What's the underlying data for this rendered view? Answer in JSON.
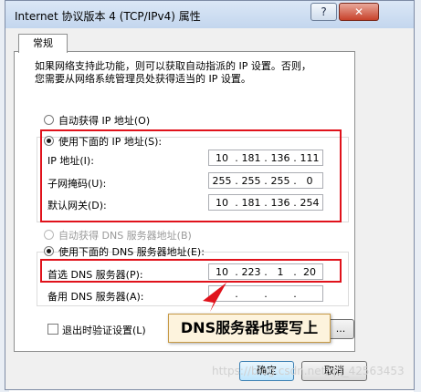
{
  "window": {
    "title": "Internet 协议版本 4 (TCP/IPv4) 属性",
    "help": "?",
    "close": "✕"
  },
  "tab": {
    "general": "常规"
  },
  "description": [
    "如果网络支持此功能，则可以获取自动指派的 IP 设置。否则，",
    "您需要从网络系统管理员处获得适当的 IP 设置。"
  ],
  "ip": {
    "auto_label": "自动获得 IP 地址(O)",
    "manual_label": "使用下面的 IP 地址(S):",
    "address_label": "IP 地址(I):",
    "address": [
      "10",
      "181",
      "136",
      "111"
    ],
    "mask_label": "子网掩码(U):",
    "mask": [
      "255",
      "255",
      "255",
      "0"
    ],
    "gateway_label": "默认网关(D):",
    "gateway": [
      "10",
      "181",
      "136",
      "254"
    ]
  },
  "dns": {
    "auto_label": "自动获得 DNS 服务器地址(B)",
    "manual_label": "使用下面的 DNS 服务器地址(E):",
    "preferred_label": "首选 DNS 服务器(P):",
    "preferred": [
      "10",
      "223",
      "1",
      "20"
    ],
    "alternate_label": "备用 DNS 服务器(A):",
    "alternate": [
      "",
      "",
      "",
      ""
    ]
  },
  "validate_label": "退出时验证设置(L)",
  "advanced_label": "...",
  "buttons": {
    "ok": "确定",
    "cancel": "取消"
  },
  "callout": "DNS服务器也要写上",
  "watermark": "https://blog.csdn.net/qq_42563453",
  "colors": {
    "highlight": "#e0121b",
    "arrow": "#e0121b",
    "callout_bg": "#fdf3dd"
  }
}
